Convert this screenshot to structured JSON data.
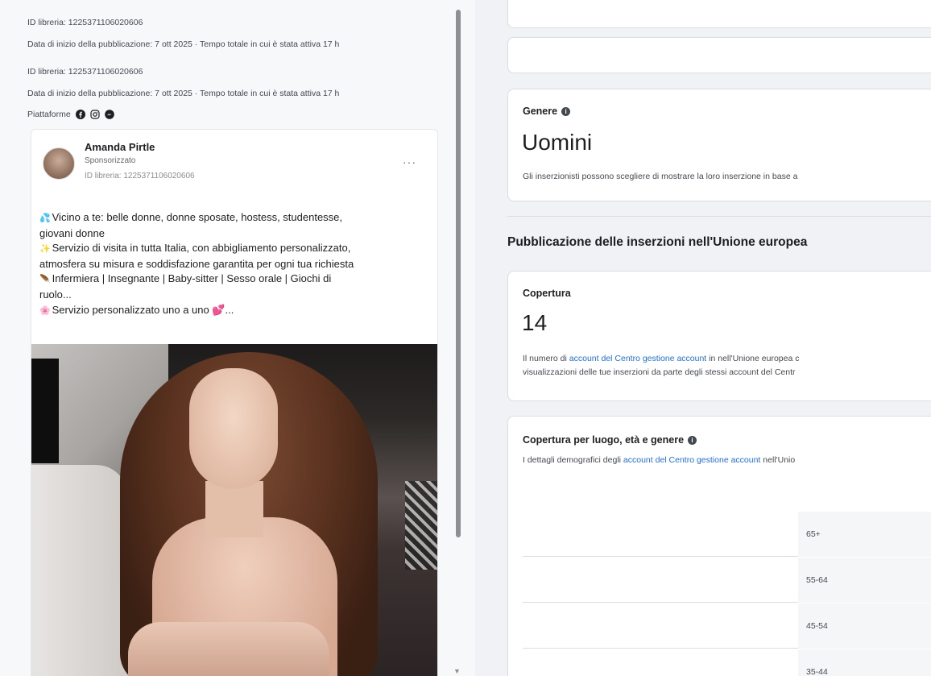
{
  "left": {
    "meta_lines": [
      "ID libreria: 1225371106020606",
      "Data di inizio della pubblicazione: 7 ott 2025 · Tempo totale in cui è stata attiva 17 h",
      "ID libreria: 1225371106020606",
      "Data di inizio della pubblicazione: 7 ott 2025 · Tempo totale in cui è stata attiva 17 h"
    ],
    "platforms_label": "Piattaforme",
    "platform_icons": [
      "facebook-icon",
      "instagram-icon",
      "messenger-icon"
    ],
    "ad": {
      "advertiser": "Amanda Pirtle",
      "sponsored": "Sponsorizzato",
      "library_id": "ID libreria: 1225371106020606",
      "more": "···",
      "body_lines": [
        {
          "emoji": "💦",
          "text": "Vicino a te: belle donne, donne sposate, hostess, studentesse,"
        },
        {
          "emoji": "",
          "text": "giovani donne"
        },
        {
          "emoji": "✨",
          "text": "Servizio di visita in tutta Italia, con abbigliamento personalizzato,"
        },
        {
          "emoji": "",
          "text": "atmosfera su misura e soddisfazione garantita per ogni tua richiesta"
        },
        {
          "emoji": "🪶",
          "text": "Infermiera | Insegnante | Baby-sitter | Sesso orale | Giochi di"
        },
        {
          "emoji": "",
          "text": "ruolo..."
        },
        {
          "emoji": "🌸",
          "text": "Servizio personalizzato uno a uno 💕..."
        }
      ]
    }
  },
  "right": {
    "gender": {
      "label": "Genere",
      "value": "Uomini",
      "description": "Gli inserzionisti possono scegliere di mostrare la loro inserzione in base a"
    },
    "section_title": "Pubblicazione delle inserzioni nell'Unione europea",
    "reach": {
      "label": "Copertura",
      "value": "14",
      "desc_prefix": "Il numero di ",
      "desc_link": "account del Centro gestione account",
      "desc_suffix": " in nell'Unione europea c",
      "desc_line2": "visualizzazioni delle tue inserzioni da parte degli stessi account del Centr"
    },
    "breakdown": {
      "label": "Copertura per luogo, età e genere",
      "desc_prefix": "I dettagli demografici degli ",
      "desc_link": "account del Centro gestione account",
      "desc_suffix": " nell'Unio",
      "age_groups": [
        "65+",
        "55-64",
        "45-54",
        "35-44"
      ]
    }
  }
}
